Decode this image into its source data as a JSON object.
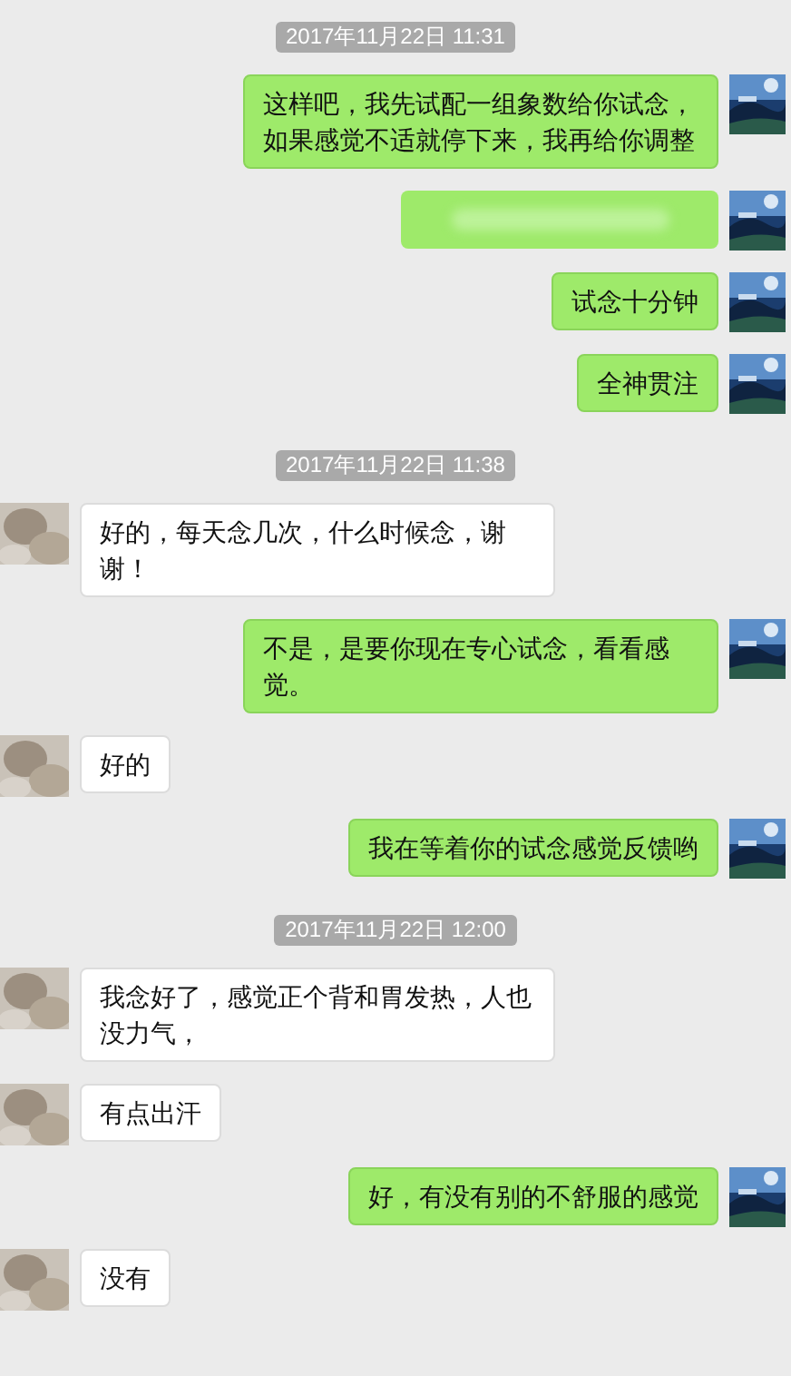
{
  "messages": [
    {
      "kind": "time",
      "text": "2017年11月22日 11:31"
    },
    {
      "kind": "sent",
      "text": "这样吧，我先试配一组象数给你试念，如果感觉不适就停下来，我再给你调整"
    },
    {
      "kind": "sent_blurred"
    },
    {
      "kind": "sent",
      "text": "试念十分钟"
    },
    {
      "kind": "sent",
      "text": "全神贯注"
    },
    {
      "kind": "time",
      "text": "2017年11月22日 11:38"
    },
    {
      "kind": "received",
      "text": "好的，每天念几次，什么时候念，谢谢！"
    },
    {
      "kind": "sent",
      "text": "不是，是要你现在专心试念，看看感觉。"
    },
    {
      "kind": "received",
      "text": "好的"
    },
    {
      "kind": "sent",
      "text": "我在等着你的试念感觉反馈哟"
    },
    {
      "kind": "time",
      "text": "2017年11月22日 12:00"
    },
    {
      "kind": "received",
      "text": "我念好了，感觉正个背和胃发热，人也没力气，"
    },
    {
      "kind": "received",
      "text": "有点出汗"
    },
    {
      "kind": "sent",
      "text": "好，有没有别的不舒服的感觉"
    },
    {
      "kind": "received",
      "text": "没有"
    }
  ]
}
